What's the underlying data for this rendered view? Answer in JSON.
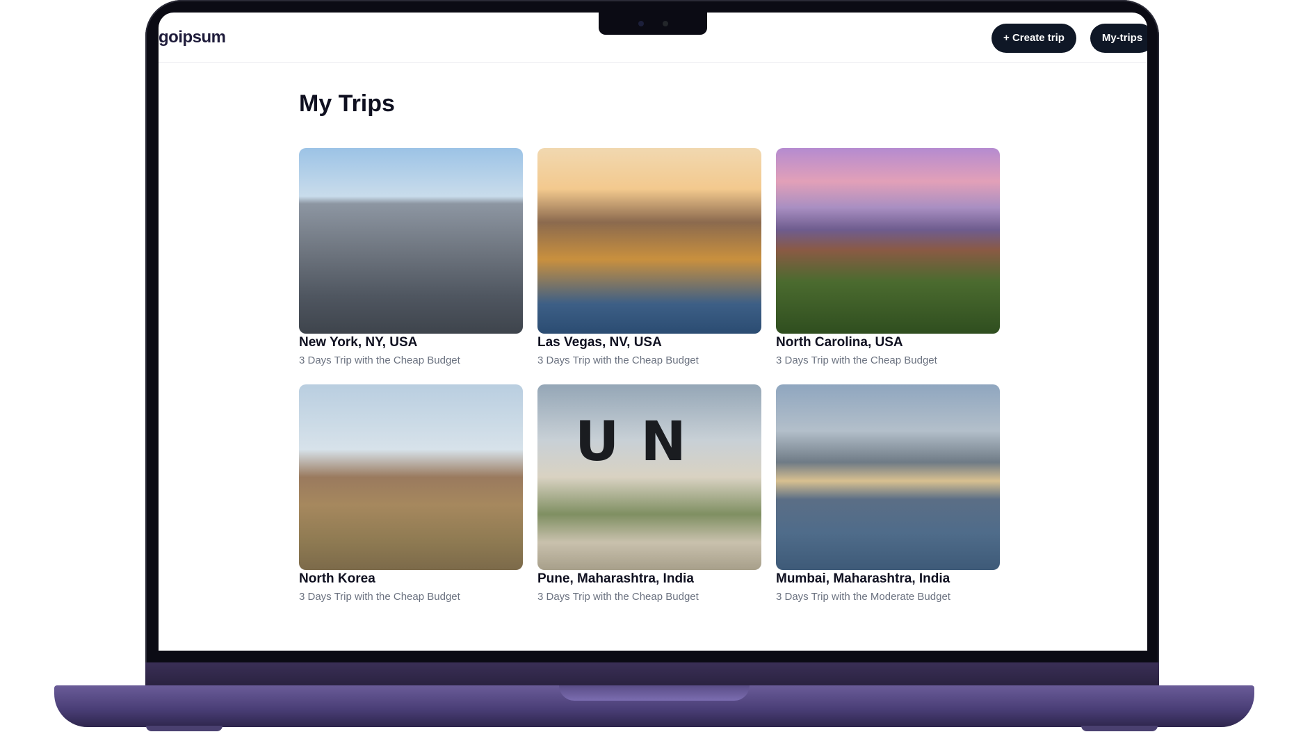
{
  "app": {
    "logo": "goipsum",
    "create_label": "+ Create trip",
    "mytrips_label": "My-trips"
  },
  "page": {
    "title": "My Trips"
  },
  "trips": [
    {
      "name": "New York, NY, USA",
      "subtitle": "3 Days Trip with the Cheap Budget"
    },
    {
      "name": "Las Vegas, NV, USA",
      "subtitle": "3 Days Trip with the Cheap Budget"
    },
    {
      "name": "North Carolina, USA",
      "subtitle": "3 Days Trip with the Cheap Budget"
    },
    {
      "name": "North Korea",
      "subtitle": "3 Days Trip with the Cheap Budget"
    },
    {
      "name": "Pune, Maharashtra, India",
      "subtitle": "3 Days Trip with the Cheap Budget",
      "photo_text": "U N"
    },
    {
      "name": "Mumbai, Maharashtra, India",
      "subtitle": "3 Days Trip with the Moderate Budget"
    }
  ]
}
